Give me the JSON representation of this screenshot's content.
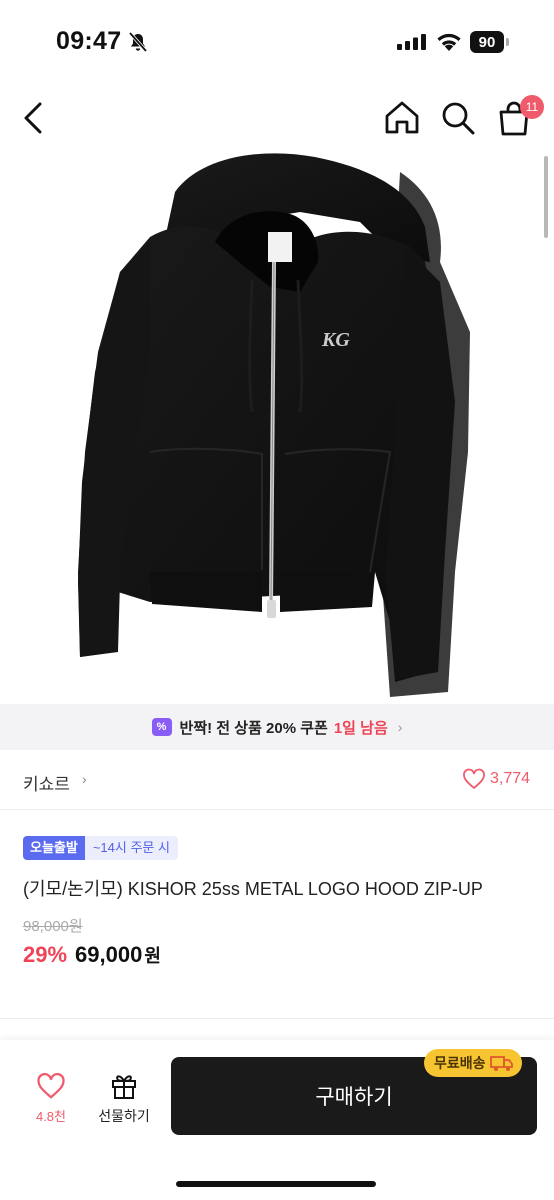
{
  "status": {
    "time": "09:47",
    "battery": "90"
  },
  "nav": {
    "cart_count": "11"
  },
  "banner": {
    "icon_text": "%",
    "text": "반짝! 전 상품 20% 쿠폰",
    "highlight": "1일 남음",
    "chevron": "›"
  },
  "brand": {
    "name": "키쇼르",
    "chevron": "›",
    "likes": "3,774"
  },
  "product": {
    "badge_today": "오늘출발",
    "badge_time": "~14시 주문 시",
    "title": "(기모/논기모) KISHOR 25ss METAL LOGO HOOD ZIP-UP",
    "original_price": "98,000원",
    "discount": "29%",
    "price": "69,000",
    "currency": "원",
    "logo_text": "KG"
  },
  "bottom": {
    "wish_count": "4.8천",
    "gift_label": "선물하기",
    "buy_label": "구매하기",
    "free_shipping": "무료배송"
  },
  "colors": {
    "accent_red": "#ef4457",
    "badge_blue": "#5b6bf0",
    "shipping_yellow": "#f7c531"
  }
}
